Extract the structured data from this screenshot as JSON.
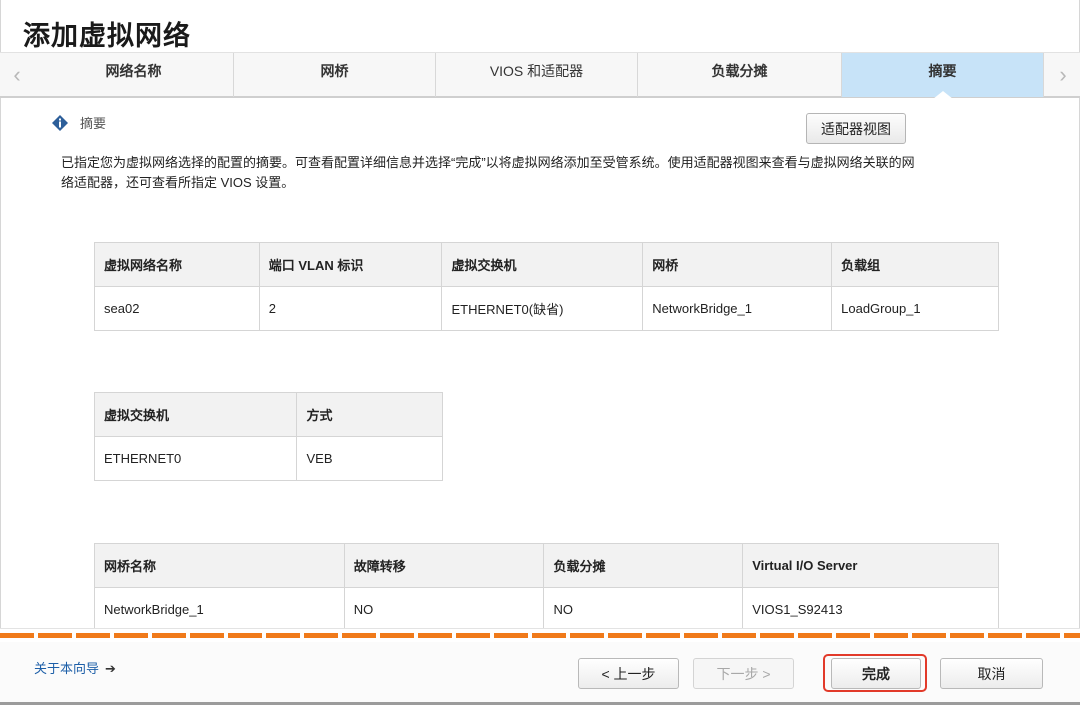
{
  "page": {
    "title": "添加虚拟网络"
  },
  "tabs": [
    {
      "label": "网络名称"
    },
    {
      "label": "网桥"
    },
    {
      "label": "VIOS 和适配器"
    },
    {
      "label": "负载分摊"
    },
    {
      "label": "摘要"
    }
  ],
  "active_tab": "摘要",
  "summary": {
    "heading": "摘要",
    "adapter_view_button": "适配器视图",
    "description": "已指定您为虚拟网络选择的配置的摘要。可查看配置详细信息并选择“完成”以将虚拟网络添加至受管系统。使用适配器视图来查看与虚拟网络关联的网络适配器，还可查看所指定 VIOS 设置。"
  },
  "network_table": {
    "headers": [
      "虚拟网络名称",
      "端口 VLAN 标识",
      "虚拟交换机",
      "网桥",
      "负载组"
    ],
    "rows": [
      [
        "sea02",
        "2",
        "ETHERNET0(缺省)",
        "NetworkBridge_1",
        "LoadGroup_1"
      ]
    ]
  },
  "switch_table": {
    "headers": [
      "虚拟交换机",
      "方式"
    ],
    "rows": [
      [
        "ETHERNET0",
        "VEB"
      ]
    ]
  },
  "bridge_table": {
    "headers": [
      "网桥名称",
      "故障转移",
      "负载分摊",
      "Virtual I/O Server"
    ],
    "rows": [
      [
        "NetworkBridge_1",
        "NO",
        "NO",
        "VIOS1_S92413"
      ]
    ]
  },
  "footer": {
    "about_link": "关于本向导",
    "about_arrow": "➔",
    "prev_button": "< 上一步",
    "next_button": "下一步 >",
    "finish_button": "完成",
    "cancel_button": "取消"
  },
  "colors": {
    "active_tab": "#c7e3f8",
    "progress_strip": "#f07a1a",
    "highlight_border": "#e23a2a",
    "link": "#1d5fa8"
  },
  "icons": {
    "tab_scroll_left": "chevron-left-icon",
    "tab_scroll_right": "chevron-right-icon",
    "section": "info-icon"
  }
}
